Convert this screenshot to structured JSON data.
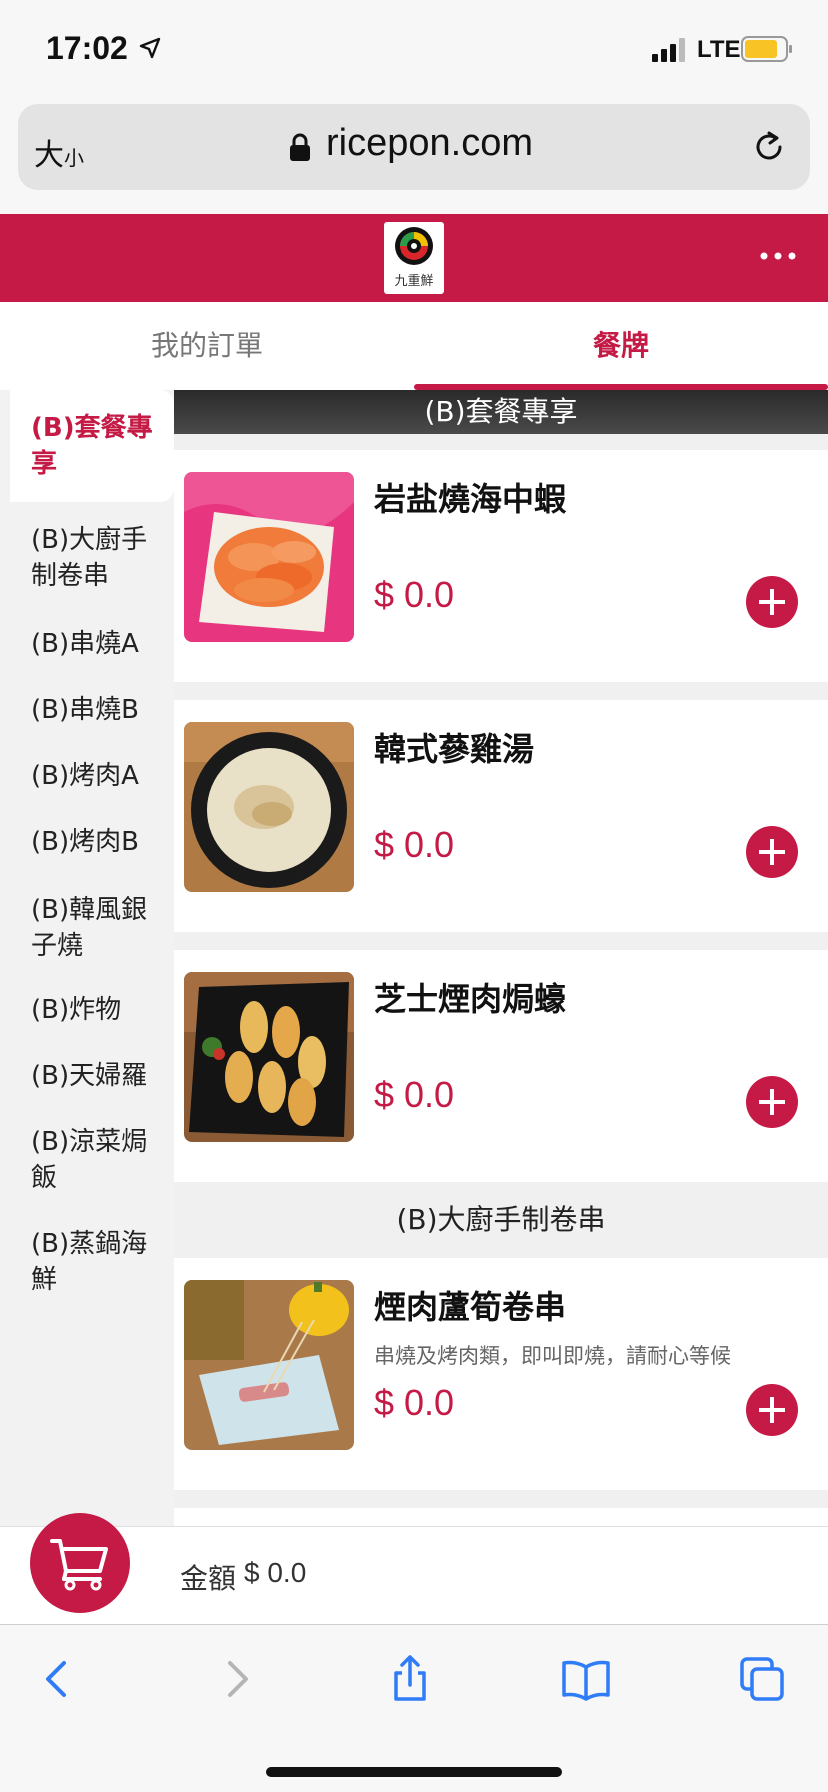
{
  "status": {
    "time": "17:02",
    "network": "LTE"
  },
  "browser": {
    "text_size": "大",
    "text_size_small": "小",
    "url": "ricepon.com"
  },
  "app": {
    "logo_text": "九重鮮",
    "brand_color": "#c41a45"
  },
  "tabs": {
    "orders": "我的訂單",
    "menu": "餐牌"
  },
  "sidebar": {
    "items": [
      {
        "label": "(B)套餐專享"
      },
      {
        "label": "(B)大廚手制卷串"
      },
      {
        "label": "(B)串燒A"
      },
      {
        "label": "(B)串燒B"
      },
      {
        "label": "(B)烤肉A"
      },
      {
        "label": "(B)烤肉B"
      },
      {
        "label": "(B)韓風銀子燒"
      },
      {
        "label": "(B)炸物"
      },
      {
        "label": "(B)天婦羅"
      },
      {
        "label": "(B)涼菜焗飯"
      },
      {
        "label": "(B)蒸鍋海鮮"
      }
    ]
  },
  "sections": [
    {
      "title": "(B)套餐專享",
      "items": [
        {
          "name": "岩盐燒海中蝦",
          "price": "$ 0.0"
        },
        {
          "name": "韓式蔘雞湯",
          "price": "$ 0.0"
        },
        {
          "name": "芝士煙肉焗蠔",
          "price": "$ 0.0"
        }
      ]
    },
    {
      "title": "(B)大廚手制卷串",
      "items": [
        {
          "name": "煙肉蘆筍卷串",
          "desc": "串燒及烤肉類，即叫即燒，請耐心等候",
          "price": "$ 0.0"
        }
      ]
    }
  ],
  "cart": {
    "label": "金額",
    "total": "$ 0.0"
  }
}
